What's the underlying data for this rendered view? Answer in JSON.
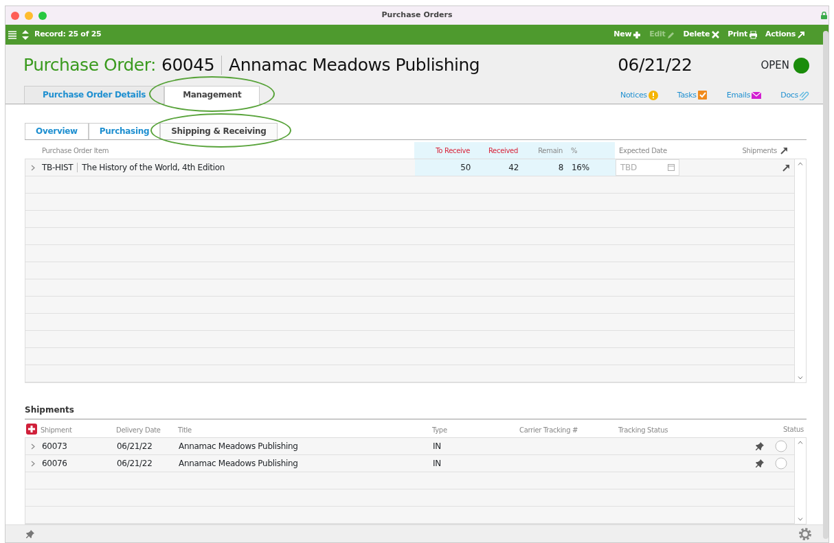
{
  "window": {
    "title": "Purchase Orders"
  },
  "toolbar": {
    "record": "Record: 25 of 25",
    "actions": [
      {
        "label": "New",
        "kind": "plus",
        "disabled": false
      },
      {
        "label": "Edit",
        "kind": "pencil",
        "disabled": true
      },
      {
        "label": "Delete",
        "kind": "x",
        "disabled": false
      },
      {
        "label": "Print",
        "kind": "printer",
        "disabled": false
      },
      {
        "label": "Actions",
        "kind": "arrow",
        "disabled": false
      }
    ]
  },
  "header": {
    "label": "Purchase Order:",
    "number": "60045",
    "vendor": "Annamac Meadows Publishing",
    "date": "06/21/22",
    "status": "OPEN"
  },
  "tabs": [
    {
      "label": "Purchase Order Details",
      "selected": false,
      "circled": false
    },
    {
      "label": "Management",
      "selected": true,
      "circled": true
    }
  ],
  "links": [
    {
      "label": "Notices",
      "kind": "alert"
    },
    {
      "label": "Tasks",
      "kind": "check"
    },
    {
      "label": "Emails",
      "kind": "mail"
    },
    {
      "label": "Docs",
      "kind": "clip"
    }
  ],
  "subtabs": [
    {
      "label": "Overview",
      "selected": false,
      "circled": false
    },
    {
      "label": "Purchasing",
      "selected": false,
      "circled": false
    },
    {
      "label": "Shipping & Receiving",
      "selected": true,
      "circled": true
    }
  ],
  "items": {
    "columns": [
      "Purchase Order Item",
      "To Receive",
      "Received",
      "Remain",
      "%",
      "Expected Date",
      "Shipments"
    ],
    "rows": [
      {
        "code": "TB-HIST",
        "name": "The History of the World, 4th Edition",
        "to_receive": "50",
        "received": "42",
        "remain": "8",
        "percent": "16%",
        "expected": "TBD"
      }
    ]
  },
  "shipments": {
    "title": "Shipments",
    "columns": [
      "Shipment",
      "Delivery Date",
      "Title",
      "Type",
      "Carrier Tracking #",
      "Tracking Status",
      "Status"
    ],
    "rows": [
      {
        "shipment": "60073",
        "delivery_date": "06/21/22",
        "title": "Annamac Meadows Publishing",
        "type": "IN"
      },
      {
        "shipment": "60076",
        "delivery_date": "06/21/22",
        "title": "Annamac Meadows Publishing",
        "type": "IN"
      }
    ]
  }
}
